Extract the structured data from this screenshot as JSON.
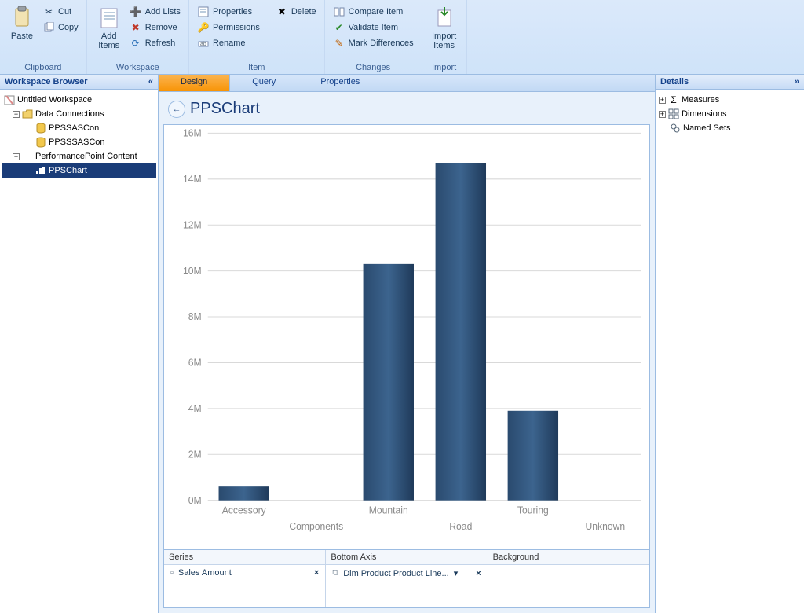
{
  "ribbon": {
    "clipboard": {
      "label": "Clipboard",
      "paste": "Paste",
      "cut": "Cut",
      "copy": "Copy"
    },
    "workspace": {
      "label": "Workspace",
      "add_items": "Add\nItems",
      "add_lists": "Add Lists",
      "remove": "Remove",
      "refresh": "Refresh"
    },
    "item": {
      "label": "Item",
      "properties": "Properties",
      "permissions": "Permissions",
      "rename": "Rename",
      "delete": "Delete"
    },
    "changes": {
      "label": "Changes",
      "compare": "Compare Item",
      "validate": "Validate Item",
      "mark": "Mark Differences"
    },
    "import": {
      "label": "Import",
      "import_items": "Import\nItems"
    }
  },
  "workspace_browser": {
    "title": "Workspace Browser",
    "root": "Untitled Workspace",
    "data_conn": "Data Connections",
    "con1": "PPSSASCon",
    "con2": "PPSSSASCon",
    "pp_content": "PerformancePoint Content",
    "ppschart": "PPSChart"
  },
  "center": {
    "tab_design": "Design",
    "tab_query": "Query",
    "tab_properties": "Properties",
    "title": "PPSChart"
  },
  "bottom": {
    "series_head": "Series",
    "series_item": "Sales Amount",
    "axis_head": "Bottom Axis",
    "axis_item": "Dim Product Product Line...",
    "bg_head": "Background"
  },
  "details": {
    "title": "Details",
    "measures": "Measures",
    "dimensions": "Dimensions",
    "named_sets": "Named Sets"
  },
  "chart_data": {
    "type": "bar",
    "categories": [
      "Accessory",
      "Components",
      "Mountain",
      "Road",
      "Touring",
      "Unknown"
    ],
    "values": [
      600000,
      0,
      10300000,
      14700000,
      3900000,
      0
    ],
    "ylim": [
      0,
      16000000
    ],
    "yticks": [
      0,
      2000000,
      4000000,
      6000000,
      8000000,
      10000000,
      12000000,
      14000000,
      16000000
    ],
    "ytick_labels": [
      "0M",
      "2M",
      "4M",
      "6M",
      "8M",
      "10M",
      "12M",
      "14M",
      "16M"
    ],
    "cat_row": [
      0,
      1,
      0,
      1,
      0,
      1
    ]
  }
}
